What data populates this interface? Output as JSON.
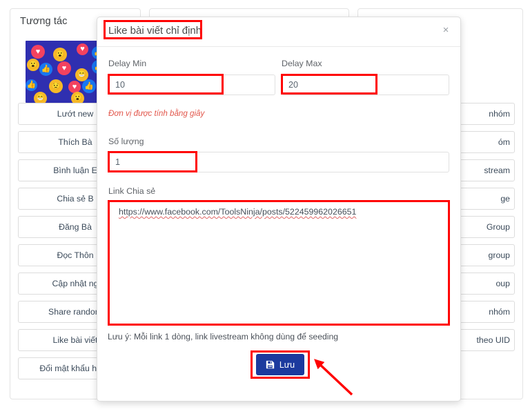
{
  "background": {
    "section_title": "Tương tác",
    "banner": {
      "name": "facebook-reactions-banner",
      "bg_color": "#2f2fb0"
    },
    "left_buttons": [
      "Lướt new",
      "Thích Bà",
      "Bình luận E",
      "Chia sẻ B",
      "Đăng Bà",
      "Đọc Thôn",
      "Cập nhật ng",
      "Share random",
      "Like bài viết",
      "Đổi mật khẩu hàng"
    ],
    "right_buttons": [
      "nhóm",
      "óm",
      "stream",
      "ge",
      "Group",
      "group",
      "oup",
      "nhóm",
      "theo UID"
    ]
  },
  "modal": {
    "title": "Like bài viết chỉ định",
    "close_label": "×",
    "delay_min": {
      "label": "Delay Min",
      "value": "10"
    },
    "delay_max": {
      "label": "Delay Max",
      "value": "20"
    },
    "unit_hint": "Đơn vị được tính bằng giây",
    "quantity": {
      "label": "Số lượng",
      "value": "1"
    },
    "link": {
      "label": "Link Chia sẻ",
      "value": "https://www.facebook.com/ToolsNinja/posts/522459962026651"
    },
    "note": "Lưu ý: Mỗi link 1 dòng, link livestream không dùng để seeding",
    "save_button": {
      "label": "Lưu",
      "icon": "floppy-disk-icon",
      "color": "#1c3a9e"
    }
  },
  "annotations": {
    "color": "#ff0000",
    "arrow": {
      "name": "red-arrow-pointing-to-save",
      "color": "#ff0000"
    }
  }
}
